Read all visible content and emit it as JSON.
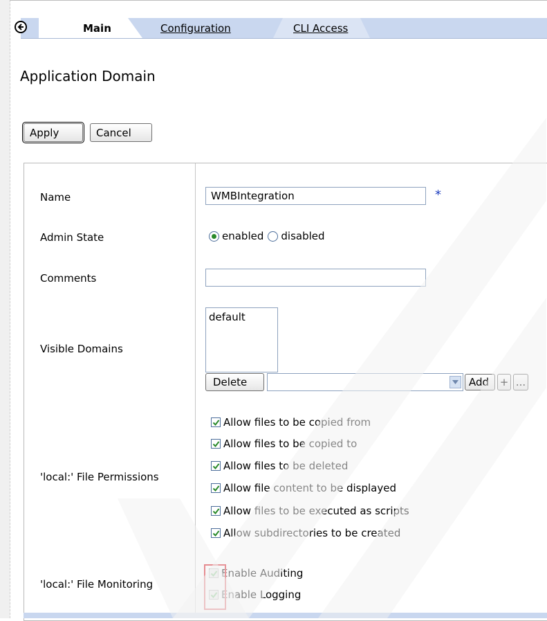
{
  "tabs": [
    {
      "label": "Main",
      "active": true
    },
    {
      "label": "Configuration",
      "active": false
    },
    {
      "label": "CLI Access",
      "active": false
    }
  ],
  "page_title": "Application Domain",
  "buttons": {
    "apply": "Apply",
    "cancel": "Cancel"
  },
  "form": {
    "name_label": "Name",
    "name_value": "WMBIntegration",
    "required_marker": "*",
    "admin_state_label": "Admin State",
    "admin_state_options": [
      "enabled",
      "disabled"
    ],
    "admin_state_selected": "enabled",
    "comments_label": "Comments",
    "comments_value": "",
    "visible_domains_label": "Visible Domains",
    "visible_domains_items": [
      "default"
    ],
    "visible_domains_buttons": {
      "delete": "Delete",
      "add": "Add",
      "plus": "+",
      "more": "..."
    },
    "file_permissions_label": "'local:' File Permissions",
    "file_permissions": [
      {
        "label": "Allow files to be copied from",
        "checked": true
      },
      {
        "label": "Allow files to be copied to",
        "checked": true
      },
      {
        "label": "Allow files to be deleted",
        "checked": true
      },
      {
        "label": "Allow file content to be displayed",
        "checked": true
      },
      {
        "label": "Allow files to be executed as scripts",
        "checked": true
      },
      {
        "label": "Allow subdirectories to be created",
        "checked": true
      }
    ],
    "file_monitoring_label": "'local:' File Monitoring",
    "file_monitoring": [
      {
        "label": "Enable Auditing",
        "checked": true
      },
      {
        "label": "Enable Logging",
        "checked": true
      }
    ]
  },
  "colors": {
    "tab_bar": "#c9d7ef",
    "check_green": "#2a8a2a",
    "highlight_red": "#d9232d"
  }
}
